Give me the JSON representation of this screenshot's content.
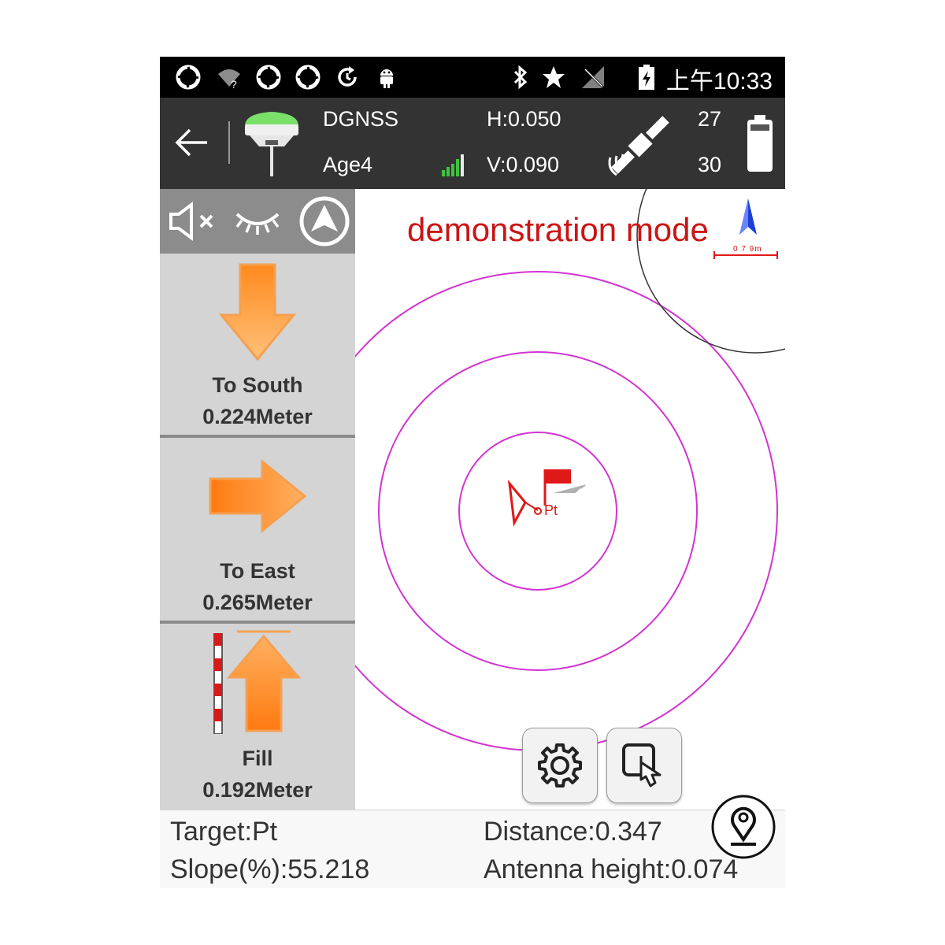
{
  "status_bar": {
    "time": "上午10:33",
    "icons": [
      "aperture-icon",
      "wifi-unknown-icon",
      "aperture-icon",
      "aperture-icon",
      "sync-icon",
      "android-icon",
      "bluetooth-icon",
      "star-icon",
      "no-signal-icon",
      "battery-charging-icon"
    ]
  },
  "gnss_bar": {
    "solution": "DGNSS",
    "age": "Age4",
    "h_precision": "H:0.050",
    "v_precision": "V:0.090",
    "sats_used": "27",
    "sats_visible": "30",
    "icons": [
      "back-arrow-icon",
      "gnss-receiver-icon",
      "signal-bars-icon",
      "satellite-icon",
      "battery-icon"
    ]
  },
  "left_panel": {
    "tools": [
      "mute-icon",
      "eye-closed-icon",
      "navigation-icon"
    ],
    "south": {
      "direction": "To South",
      "value": "0.224Meter"
    },
    "east": {
      "direction": "To East",
      "value": "0.265Meter"
    },
    "fill": {
      "direction": "Fill",
      "value": "0.192Meter"
    }
  },
  "map": {
    "mode_text": "demonstration mode",
    "scale_text": "0 7 9m",
    "point_label": "Pt",
    "colors": {
      "rings": "#d233d2",
      "target": "#e01818",
      "demo_text": "#cc1414",
      "north_arrow": "#1a3fd4"
    },
    "buttons": [
      "map-layer-button",
      "full-extent-button",
      "locate-button",
      "zoom-in-button",
      "zoom-out-button",
      "collapse-button",
      "settings-button",
      "touch-mode-button"
    ]
  },
  "bottom_bar": {
    "target": "Target:Pt",
    "distance": "Distance:0.347",
    "slope": "Slope(%):55.218",
    "antenna_height": "Antenna height:0.074"
  }
}
